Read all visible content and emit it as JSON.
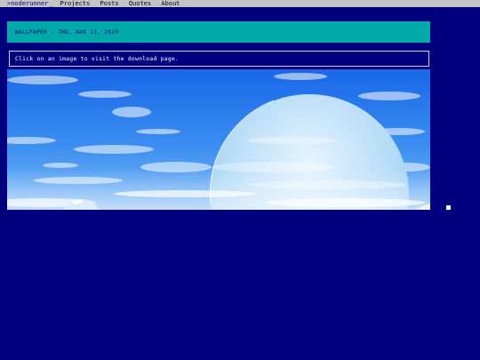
{
  "header": {
    "brand": ">noderunner",
    "cursor": "_",
    "nav": [
      "Projects",
      "Posts",
      "Quotes",
      "About"
    ]
  },
  "banner": {
    "title": "WALLPAPER - THU, AUG 13, 2020"
  },
  "hint": {
    "text": "Click on an image to visit the download page."
  },
  "wallpaper": {
    "subject": "planet-over-sky-image"
  },
  "colors": {
    "background": "#00007f",
    "topbar": "#c4c4c4",
    "banner": "#00aaa8",
    "text": "#ffffff"
  }
}
